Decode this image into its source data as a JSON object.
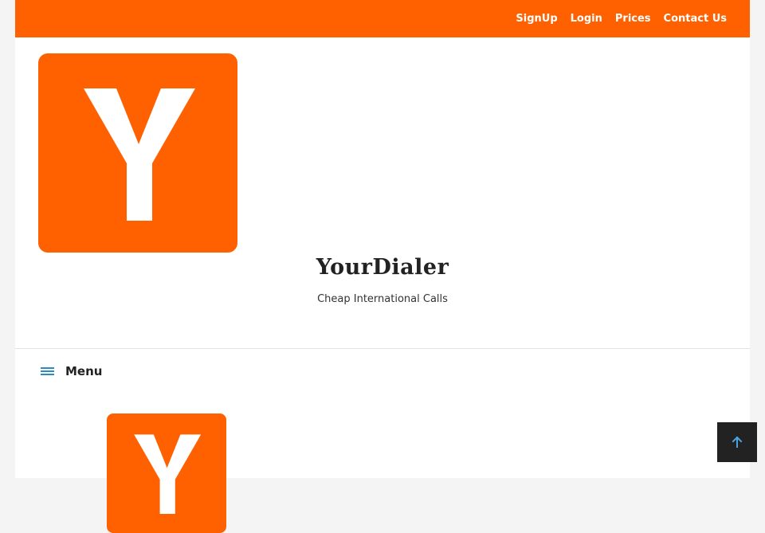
{
  "header": {
    "nav": [
      {
        "label": "SignUp"
      },
      {
        "label": "Login"
      },
      {
        "label": "Prices"
      },
      {
        "label": "Contact Us"
      }
    ]
  },
  "branding": {
    "title": "YourDialer",
    "tagline": "Cheap International Calls",
    "logo_letter": "Y"
  },
  "menu": {
    "label": "Menu"
  },
  "colors": {
    "brand": "#ff6100",
    "menu_icon": "#2b8cc4",
    "back_to_top_bg": "#222222"
  },
  "icons": {
    "menu": "hamburger-icon",
    "back_to_top": "arrow-up-icon"
  }
}
